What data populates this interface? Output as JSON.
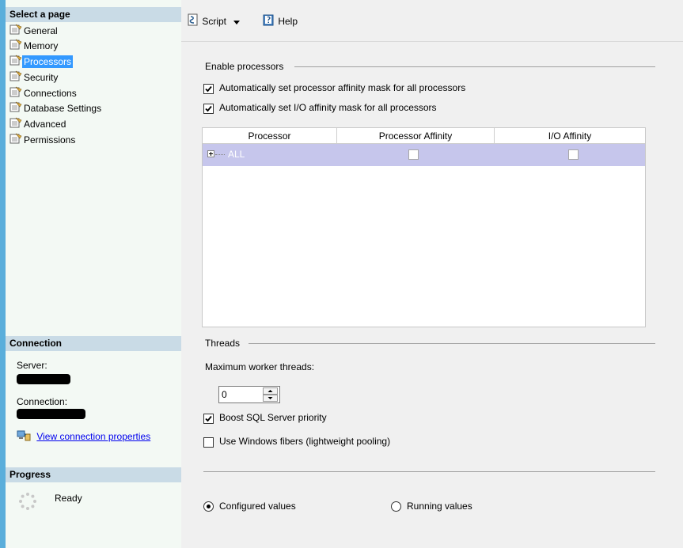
{
  "left": {
    "select_page_header": "Select a page",
    "pages": [
      {
        "label": "General"
      },
      {
        "label": "Memory"
      },
      {
        "label": "Processors"
      },
      {
        "label": "Security"
      },
      {
        "label": "Connections"
      },
      {
        "label": "Database Settings"
      },
      {
        "label": "Advanced"
      },
      {
        "label": "Permissions"
      }
    ],
    "connection_header": "Connection",
    "server_label": "Server:",
    "connection_label": "Connection:",
    "view_connection_link": "View connection properties",
    "progress_header": "Progress",
    "progress_status": "Ready"
  },
  "toolbar": {
    "script_label": "Script",
    "help_label": "Help"
  },
  "processors": {
    "enable_group": "Enable processors",
    "auto_affinity_label": "Automatically set processor affinity mask for all processors",
    "auto_io_affinity_label": "Automatically set I/O affinity mask for all processors",
    "grid_columns": [
      "Processor",
      "Processor Affinity",
      "I/O Affinity"
    ],
    "grid_row": {
      "processor": "ALL",
      "processor_affinity": false,
      "io_affinity": false
    }
  },
  "threads": {
    "group_label": "Threads",
    "max_worker_label": "Maximum worker threads:",
    "max_worker_value": "0",
    "boost_label": "Boost SQL Server priority",
    "boost_checked": true,
    "fibers_label": "Use Windows fibers (lightweight pooling)",
    "fibers_checked": false
  },
  "view_mode": {
    "configured_label": "Configured  values",
    "running_label": "Running values",
    "selected": "configured"
  }
}
